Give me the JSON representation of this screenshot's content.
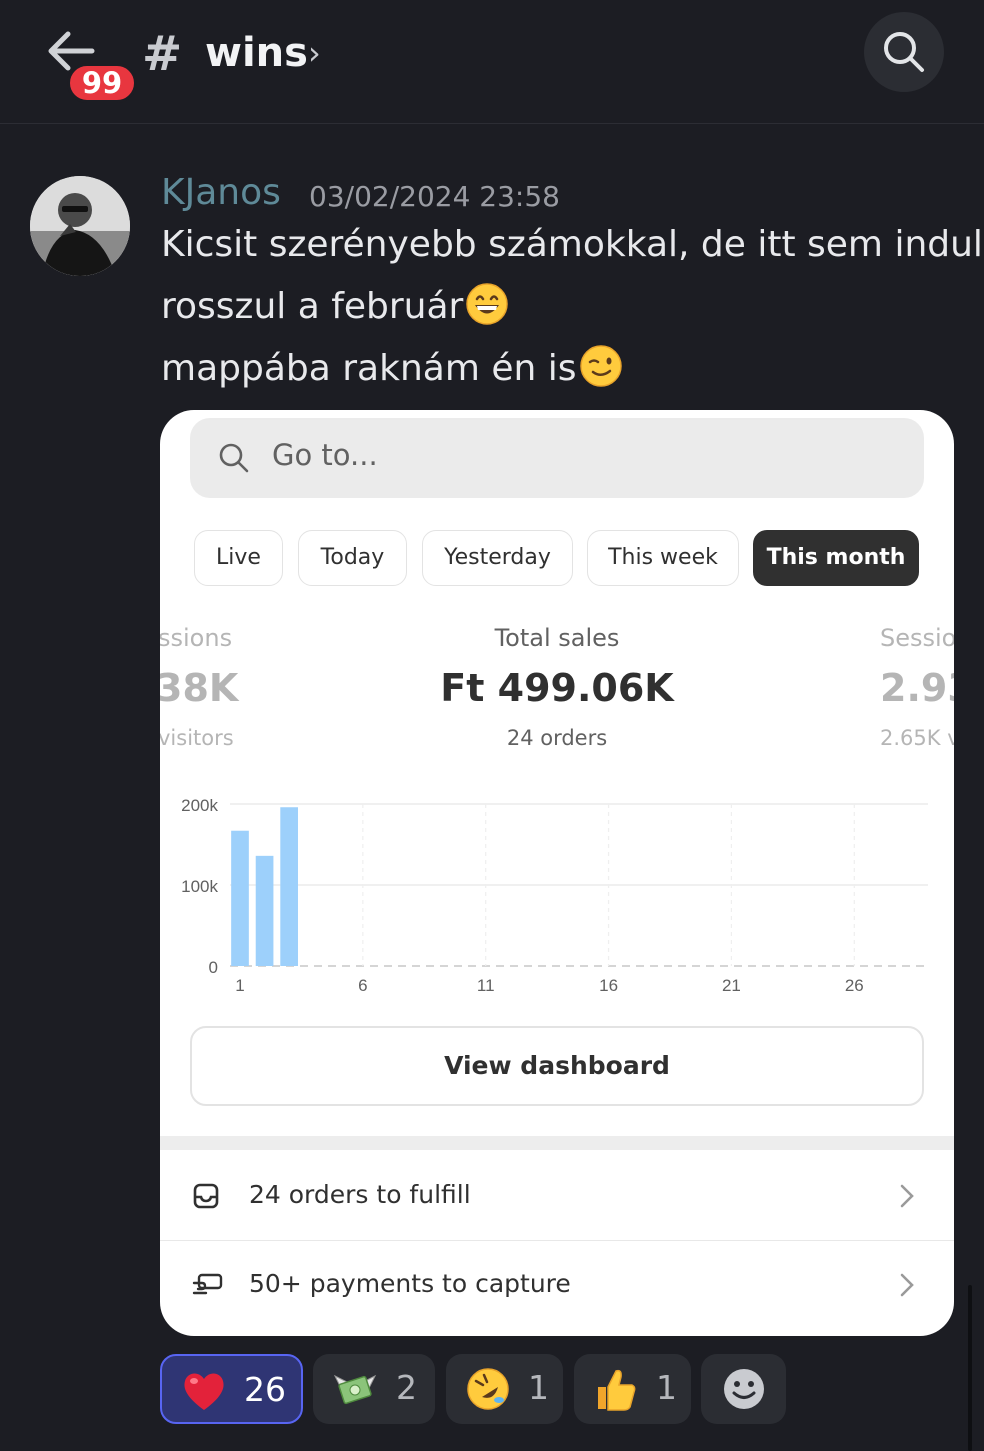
{
  "header": {
    "unread_badge": "99",
    "hash": "#",
    "channel": "wins",
    "chevron": "›"
  },
  "message": {
    "author": "KJanos",
    "timestamp": "03/02/2024 23:58",
    "lines": [
      "Kicsit szerényebb számokkal, de itt sem indul",
      "rosszul a február",
      "mappába raknám én is"
    ]
  },
  "embed": {
    "search_placeholder": "Go to...",
    "filters": [
      "Live",
      "Today",
      "Yesterday",
      "This week",
      "This month"
    ],
    "active_filter": "This month",
    "metrics": {
      "left": {
        "label": "ssions",
        "value": "38K",
        "sub": "visitors"
      },
      "center": {
        "label": "Total sales",
        "value": "Ft 499.06K",
        "sub": "24 orders"
      },
      "right": {
        "label": "Sessio",
        "value": "2.93",
        "sub": "2.65K v"
      }
    },
    "view_dashboard": "View dashboard",
    "tasks": [
      {
        "label": "24 orders to fulfill",
        "icon": "inbox-icon"
      },
      {
        "label": "50+ payments to capture",
        "icon": "payment-icon"
      }
    ]
  },
  "chart_data": {
    "type": "bar",
    "x": [
      1,
      2,
      3
    ],
    "values": [
      167000,
      136000,
      196000
    ],
    "x_ticks": [
      "1",
      "6",
      "11",
      "16",
      "21",
      "26"
    ],
    "y_ticks": [
      "200k",
      "100k",
      "0"
    ],
    "xlim": [
      1,
      29
    ],
    "ylim": [
      0,
      200000
    ],
    "bar_color": "#9dd0fb",
    "grid": true
  },
  "reactions": [
    {
      "emoji": "heart",
      "count": "26",
      "me": true
    },
    {
      "emoji": "money-with-wings",
      "count": "2",
      "me": false
    },
    {
      "emoji": "rofl",
      "count": "1",
      "me": false
    },
    {
      "emoji": "thumbs-up",
      "count": "1",
      "me": false
    },
    {
      "emoji": "add-reaction",
      "count": "",
      "me": false
    }
  ],
  "colors": {
    "background": "#1c1d23",
    "username": "#5f8a98",
    "badge": "#e8363f",
    "reaction_selected": "#5865f2"
  }
}
